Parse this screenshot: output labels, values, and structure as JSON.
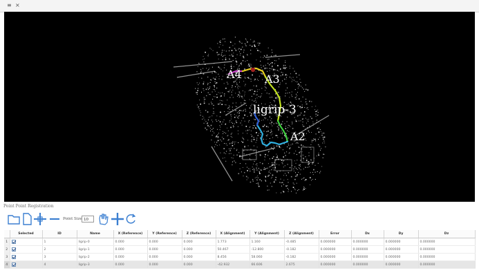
{
  "window": {
    "controls": [
      "≡",
      "×"
    ]
  },
  "viewport": {
    "labels": {
      "a4": "A4",
      "a3": "A3",
      "a2": "A2",
      "center": "ligrip-3"
    }
  },
  "panel": {
    "title": "Point Point Registration"
  },
  "toolbar": {
    "point_size_label": "Point Size",
    "point_size_value": "10",
    "icons": [
      "folder-open-icon",
      "new-file-icon",
      "add-point-icon",
      "remove-point-icon",
      "hand-icon",
      "move-icon",
      "rotate-icon"
    ]
  },
  "table": {
    "headers": [
      "Selected",
      "ID",
      "Name",
      "X (Reference)",
      "Y (Reference)",
      "Z (Reference)",
      "X (Alignment)",
      "Y (Alignment)",
      "Z (Alignment)",
      "Error",
      "Dx",
      "Dy",
      "Dz"
    ],
    "rows": [
      {
        "num": "1",
        "id": "1",
        "name": "ligrip-0",
        "xr": "0.000",
        "yr": "0.000",
        "zr": "0.000",
        "xa": "1.773",
        "ya": "1.160",
        "za": "-0.485",
        "err": "0.000000",
        "dx": "0.000000",
        "dy": "0.000000",
        "dz": "0.000000"
      },
      {
        "num": "2",
        "id": "2",
        "name": "ligrip-1",
        "xr": "0.000",
        "yr": "0.000",
        "zr": "0.000",
        "xa": "50.467",
        "ya": "-12.800",
        "za": "-0.182",
        "err": "0.000000",
        "dx": "0.000000",
        "dy": "0.000000",
        "dz": "0.000000"
      },
      {
        "num": "3",
        "id": "3",
        "name": "ligrip-2",
        "xr": "0.000",
        "yr": "0.000",
        "zr": "0.000",
        "xa": "8.456",
        "ya": "58.060",
        "za": "-0.182",
        "err": "0.000000",
        "dx": "0.000000",
        "dy": "0.000000",
        "dz": "0.000000"
      },
      {
        "num": "4",
        "id": "4",
        "name": "ligrip-3",
        "xr": "0.000",
        "yr": "0.000",
        "zr": "0.000",
        "xa": "-42.932",
        "ya": "66.606",
        "za": "2.675",
        "err": "0.000000",
        "dx": "0.000000",
        "dy": "0.000000",
        "dz": "0.000000"
      }
    ]
  },
  "colors": {
    "viewport_bg": "#000000",
    "trajectory": [
      "#cc44cc",
      "#e8d020",
      "#c0e020",
      "#40d040",
      "#30b0e0",
      "#3060d8"
    ],
    "icon_blue": "#3b7fd1"
  }
}
